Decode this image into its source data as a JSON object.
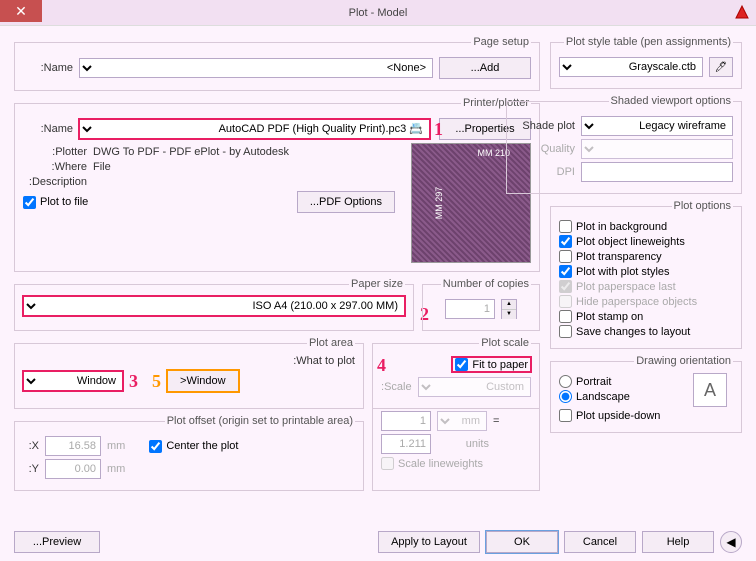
{
  "title": "Plot - Model",
  "page_setup": {
    "legend": "Page setup",
    "name_label": "Name:",
    "name_value": "<None>",
    "add_btn": "Add..."
  },
  "printer": {
    "legend": "Printer/plotter",
    "name_label": "Name:",
    "name_value": "📇 AutoCAD PDF (High Quality Print).pc3",
    "properties_btn": "Properties...",
    "plotter_label": "Plotter:",
    "plotter_value": "DWG To PDF - PDF ePlot - by Autodesk",
    "where_label": "Where:",
    "where_value": "File",
    "desc_label": "Description:",
    "plot_to_file": "Plot to file",
    "pdf_options_btn": "PDF Options...",
    "preview_w": "210 MM",
    "preview_h": "297 MM"
  },
  "paper": {
    "legend": "Paper size",
    "value": "ISO A4 (210.00 x 297.00 MM)",
    "copies_label": "Number of copies",
    "copies_value": "1"
  },
  "area": {
    "legend": "Plot area",
    "what_label": "What to plot:",
    "what_value": "Window",
    "window_btn": "Window<"
  },
  "offset": {
    "legend": "Plot offset (origin set to printable area)",
    "x_label": "X:",
    "x_value": "16.58",
    "y_label": "Y:",
    "y_value": "0.00",
    "mm": "mm",
    "center": "Center the plot"
  },
  "scale": {
    "legend": "Plot scale",
    "fit": "Fit to paper",
    "scale_label": "Scale:",
    "scale_value": "Custom",
    "num_value": "1",
    "num_unit": "mm",
    "eq": "=",
    "den_value": "1.211",
    "den_unit": "units",
    "scale_lw": "Scale lineweights"
  },
  "style_table": {
    "legend": "Plot style table (pen assignments)",
    "value": "Grayscale.ctb"
  },
  "shaded": {
    "legend": "Shaded viewport options",
    "shade_label": "Shade plot",
    "shade_value": "Legacy wireframe",
    "quality_label": "Quality",
    "dpi_label": "DPI"
  },
  "plot_opts": {
    "legend": "Plot options",
    "bg": "Plot in background",
    "lw": "Plot object lineweights",
    "trans": "Plot transparency",
    "styles": "Plot with plot styles",
    "paperspace": "Plot paperspace last",
    "hide": "Hide paperspace objects",
    "stamp": "Plot stamp on",
    "save": "Save changes to layout"
  },
  "orient": {
    "legend": "Drawing orientation",
    "portrait": "Portrait",
    "landscape": "Landscape",
    "upside": "Plot upside-down",
    "glyph": "A"
  },
  "footer": {
    "preview": "Preview...",
    "apply": "Apply to Layout",
    "ok": "OK",
    "cancel": "Cancel",
    "help": "Help"
  },
  "annotations": {
    "n1": "1",
    "n2": "2",
    "n3": "3",
    "n4": "4",
    "n5": "5"
  }
}
